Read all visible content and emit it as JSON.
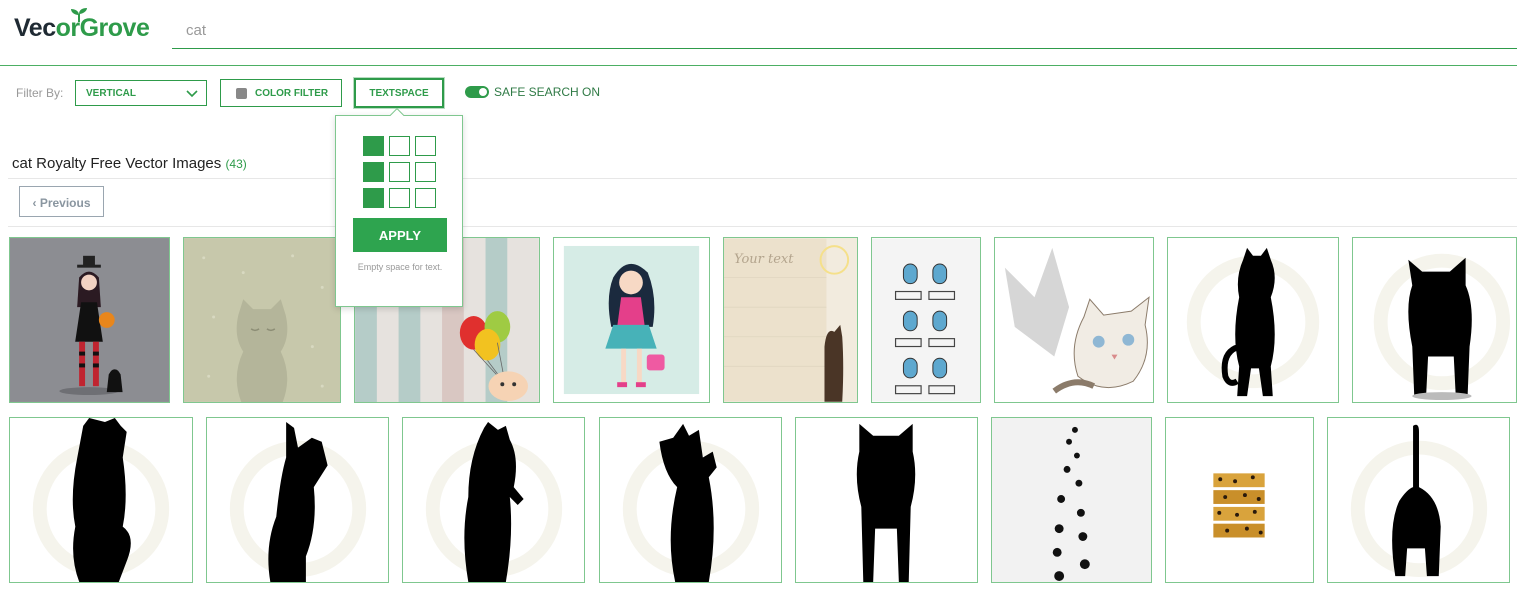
{
  "app": {
    "brand_part1": "Vec",
    "brand_part2": "orGrove",
    "brand_icon": "leaf-sprout-icon"
  },
  "search": {
    "value": "cat",
    "placeholder": "cat"
  },
  "filters": {
    "label": "Filter By:",
    "orientation_selected": "VERTICAL",
    "color_filter_label": "COLOR FILTER",
    "textspace_label": "TEXTSPACE",
    "safe_search_label": "SAFE SEARCH ON",
    "safe_search_on": true
  },
  "results": {
    "query_title": "cat Royalty Free Vector Images",
    "count": "(43)"
  },
  "pagination": {
    "previous_label": "‹ Previous"
  },
  "textspace_popup": {
    "grid": [
      [
        true,
        false,
        false
      ],
      [
        true,
        false,
        false
      ],
      [
        true,
        false,
        false
      ]
    ],
    "apply_label": "APPLY",
    "hint": "Empty space for text."
  },
  "thumbnails_row1": [
    {
      "subject": "gothic-girl-with-pumpkin"
    },
    {
      "subject": "sleepy-cat-pattern"
    },
    {
      "subject": "cat-with-balloons"
    },
    {
      "subject": "girl-with-handbag"
    },
    {
      "subject": "your-text-brick-wall-cat",
      "caption": "Your text"
    },
    {
      "subject": "building-windows-cats"
    },
    {
      "subject": "cat-with-shadow"
    },
    {
      "subject": "cat-silhouette-stretching"
    },
    {
      "subject": "cat-silhouette-standing"
    }
  ],
  "thumbnails_row2": [
    {
      "subject": "cat-silhouette-reaching"
    },
    {
      "subject": "cat-silhouette-pawing"
    },
    {
      "subject": "cat-silhouette-upright"
    },
    {
      "subject": "cat-silhouette-looking-up"
    },
    {
      "subject": "cat-silhouette-front"
    },
    {
      "subject": "cat-paw-prints"
    },
    {
      "subject": "leopard-print-strips"
    },
    {
      "subject": "cat-silhouette-tail-up"
    }
  ],
  "colors": {
    "accent": "#2e9b4a",
    "text_dark": "#1f2a33"
  }
}
